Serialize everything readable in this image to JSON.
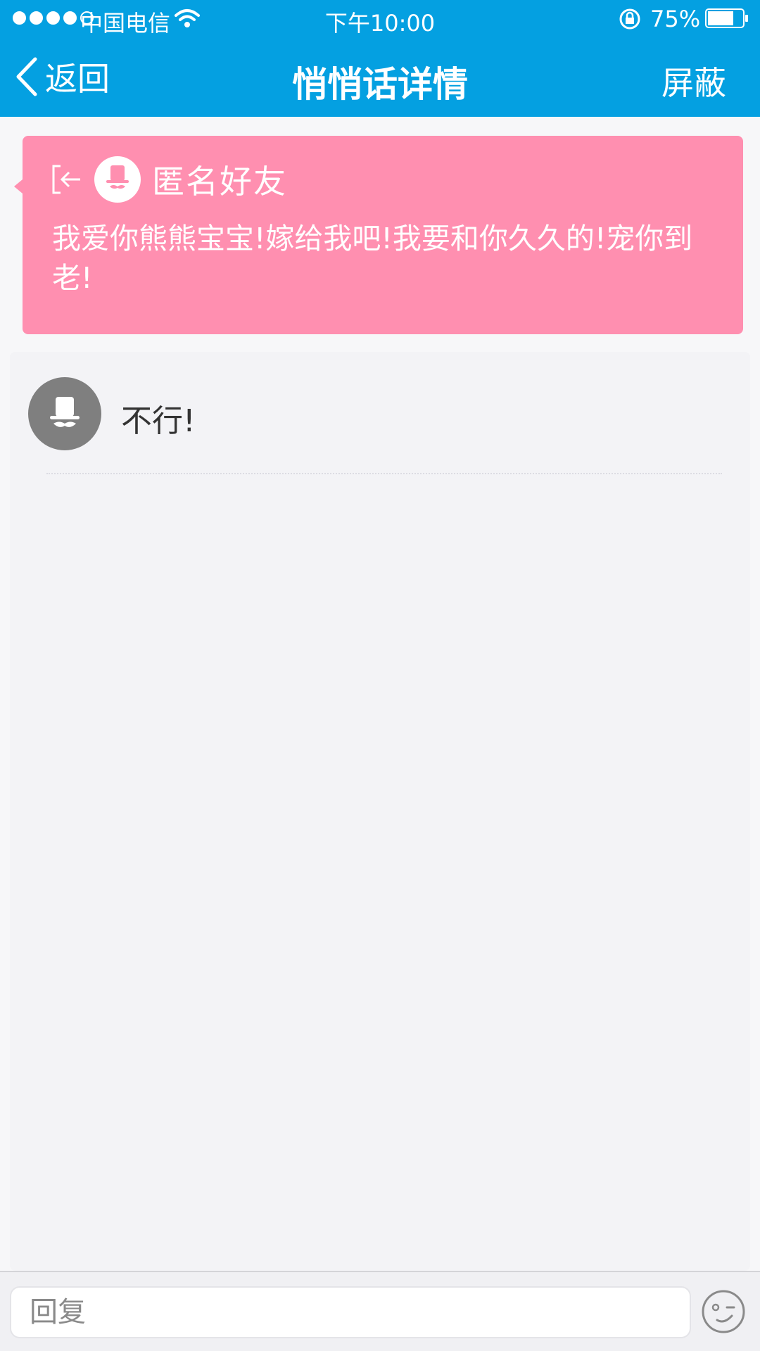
{
  "status_bar": {
    "carrier": "中国电信",
    "time": "下午10:00",
    "battery_percent": "75%",
    "battery_level": 0.75,
    "signal_bars": 4,
    "signal_total": 5
  },
  "nav": {
    "back_label": "返回",
    "title": "悄悄话详情",
    "block_label": "屏蔽"
  },
  "whisper": {
    "sender": "匿名好友",
    "message": "我爱你熊熊宝宝!嫁给我吧!我要和你久久的!宠你到老!",
    "card_color": "#ff8fb0"
  },
  "replies": [
    {
      "text": "不行!"
    }
  ],
  "reply_bar": {
    "placeholder": "回复"
  },
  "icons": {
    "back": "chevron-left-icon",
    "exit": "exit-arrow-icon",
    "avatar": "anonymous-hat-mustache-icon",
    "emoji": "wink-face-icon"
  },
  "colors": {
    "header": "#04a0e1",
    "card": "#ff8fb0",
    "panel": "#f3f3f6"
  }
}
